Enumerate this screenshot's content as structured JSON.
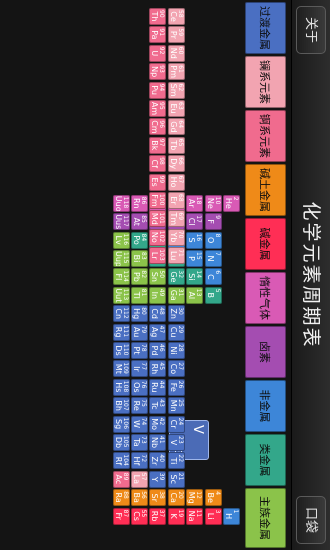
{
  "header": {
    "about_label": "关于",
    "title": "化学元素周期表",
    "back_label": "口袋"
  },
  "legend": [
    {
      "label": "过渡金属",
      "color": "#4a6fc2"
    },
    {
      "label": "镧系元素",
      "color": "#f2a4b1"
    },
    {
      "label": "锕系元素",
      "color": "#f06b8e"
    },
    {
      "label": "碱土金属",
      "color": "#ef8a18"
    },
    {
      "label": "碱金属",
      "color": "#ff2e55"
    },
    {
      "label": "惰性气体",
      "color": "#d95ab5"
    },
    {
      "label": "卤素",
      "color": "#a44db1"
    },
    {
      "label": "非金属",
      "color": "#3d86d8"
    },
    {
      "label": "类金属",
      "color": "#33a78a"
    },
    {
      "label": "主族金属",
      "color": "#8bc34a"
    }
  ],
  "popup": {
    "symbol": "V",
    "number": "23"
  },
  "elements": [
    {
      "s": "H",
      "n": "1",
      "c": "#3d86d8"
    },
    {
      "s": "He",
      "n": "2",
      "c": "#d95ab5"
    },
    {
      "s": "Li",
      "n": "3",
      "c": "#ff2e55"
    },
    {
      "s": "Be",
      "n": "4",
      "c": "#ef8a18"
    },
    {
      "s": "B",
      "n": "5",
      "c": "#33a78a"
    },
    {
      "s": "C",
      "n": "6",
      "c": "#3d86d8"
    },
    {
      "s": "N",
      "n": "7",
      "c": "#3d86d8"
    },
    {
      "s": "O",
      "n": "8",
      "c": "#3d86d8"
    },
    {
      "s": "F",
      "n": "9",
      "c": "#a44db1"
    },
    {
      "s": "Ne",
      "n": "10",
      "c": "#d95ab5"
    },
    {
      "s": "Na",
      "n": "11",
      "c": "#ff2e55"
    },
    {
      "s": "Mg",
      "n": "12",
      "c": "#ef8a18"
    },
    {
      "s": "Al",
      "n": "13",
      "c": "#8bc34a"
    },
    {
      "s": "Si",
      "n": "14",
      "c": "#33a78a"
    },
    {
      "s": "P",
      "n": "15",
      "c": "#3d86d8"
    },
    {
      "s": "S",
      "n": "16",
      "c": "#3d86d8"
    },
    {
      "s": "Cl",
      "n": "17",
      "c": "#a44db1"
    },
    {
      "s": "Ar",
      "n": "18",
      "c": "#d95ab5"
    },
    {
      "s": "K",
      "n": "19",
      "c": "#ff2e55"
    },
    {
      "s": "Ca",
      "n": "20",
      "c": "#ef8a18"
    },
    {
      "s": "Sc",
      "n": "21",
      "c": "#4a6fc2"
    },
    {
      "s": "Ti",
      "n": "22",
      "c": "#4a6fc2"
    },
    {
      "s": "V",
      "n": "23",
      "c": "#4a6fc2"
    },
    {
      "s": "Cr",
      "n": "24",
      "c": "#4a6fc2"
    },
    {
      "s": "Mn",
      "n": "25",
      "c": "#4a6fc2"
    },
    {
      "s": "Fe",
      "n": "26",
      "c": "#4a6fc2"
    },
    {
      "s": "Co",
      "n": "27",
      "c": "#4a6fc2"
    },
    {
      "s": "Ni",
      "n": "28",
      "c": "#4a6fc2"
    },
    {
      "s": "Cu",
      "n": "29",
      "c": "#4a6fc2"
    },
    {
      "s": "Zn",
      "n": "30",
      "c": "#4a6fc2"
    },
    {
      "s": "Ga",
      "n": "31",
      "c": "#8bc34a"
    },
    {
      "s": "Ge",
      "n": "32",
      "c": "#33a78a"
    },
    {
      "s": "As",
      "n": "33",
      "c": "#33a78a"
    },
    {
      "s": "Se",
      "n": "34",
      "c": "#3d86d8"
    },
    {
      "s": "Br",
      "n": "35",
      "c": "#a44db1"
    },
    {
      "s": "Kr",
      "n": "36",
      "c": "#d95ab5"
    },
    {
      "s": "Rb",
      "n": "37",
      "c": "#ff2e55"
    },
    {
      "s": "Sr",
      "n": "38",
      "c": "#ef8a18"
    },
    {
      "s": "Y",
      "n": "39",
      "c": "#4a6fc2"
    },
    {
      "s": "Zr",
      "n": "40",
      "c": "#4a6fc2"
    },
    {
      "s": "Nb",
      "n": "41",
      "c": "#4a6fc2"
    },
    {
      "s": "Mo",
      "n": "42",
      "c": "#4a6fc2"
    },
    {
      "s": "Tc",
      "n": "43",
      "c": "#4a6fc2"
    },
    {
      "s": "Ru",
      "n": "44",
      "c": "#4a6fc2"
    },
    {
      "s": "Rh",
      "n": "45",
      "c": "#4a6fc2"
    },
    {
      "s": "Pd",
      "n": "46",
      "c": "#4a6fc2"
    },
    {
      "s": "Ag",
      "n": "47",
      "c": "#4a6fc2"
    },
    {
      "s": "Cd",
      "n": "48",
      "c": "#4a6fc2"
    },
    {
      "s": "In",
      "n": "49",
      "c": "#8bc34a"
    },
    {
      "s": "Sn",
      "n": "50",
      "c": "#8bc34a"
    },
    {
      "s": "Sb",
      "n": "51",
      "c": "#33a78a"
    },
    {
      "s": "Te",
      "n": "52",
      "c": "#33a78a"
    },
    {
      "s": "I",
      "n": "53",
      "c": "#a44db1"
    },
    {
      "s": "Xe",
      "n": "54",
      "c": "#d95ab5"
    },
    {
      "s": "Cs",
      "n": "55",
      "c": "#ff2e55"
    },
    {
      "s": "Ba",
      "n": "56",
      "c": "#ef8a18"
    },
    {
      "s": "La",
      "n": "57",
      "c": "#f2a4b1"
    },
    {
      "s": "Hf",
      "n": "72",
      "c": "#4a6fc2"
    },
    {
      "s": "Ta",
      "n": "73",
      "c": "#4a6fc2"
    },
    {
      "s": "W",
      "n": "74",
      "c": "#4a6fc2"
    },
    {
      "s": "Re",
      "n": "75",
      "c": "#4a6fc2"
    },
    {
      "s": "Os",
      "n": "76",
      "c": "#4a6fc2"
    },
    {
      "s": "Ir",
      "n": "77",
      "c": "#4a6fc2"
    },
    {
      "s": "Pt",
      "n": "78",
      "c": "#4a6fc2"
    },
    {
      "s": "Au",
      "n": "79",
      "c": "#4a6fc2"
    },
    {
      "s": "Hg",
      "n": "80",
      "c": "#4a6fc2"
    },
    {
      "s": "Tl",
      "n": "81",
      "c": "#8bc34a"
    },
    {
      "s": "Pb",
      "n": "82",
      "c": "#8bc34a"
    },
    {
      "s": "Bi",
      "n": "83",
      "c": "#8bc34a"
    },
    {
      "s": "Po",
      "n": "84",
      "c": "#33a78a"
    },
    {
      "s": "At",
      "n": "85",
      "c": "#a44db1"
    },
    {
      "s": "Rn",
      "n": "86",
      "c": "#d95ab5"
    },
    {
      "s": "Fr",
      "n": "87",
      "c": "#ff2e55"
    },
    {
      "s": "Ra",
      "n": "88",
      "c": "#ef8a18"
    },
    {
      "s": "Ac",
      "n": "89",
      "c": "#f06b8e"
    },
    {
      "s": "Rf",
      "n": "104",
      "c": "#4a6fc2"
    },
    {
      "s": "Db",
      "n": "105",
      "c": "#4a6fc2"
    },
    {
      "s": "Sg",
      "n": "106",
      "c": "#4a6fc2"
    },
    {
      "s": "Bh",
      "n": "107",
      "c": "#4a6fc2"
    },
    {
      "s": "Hs",
      "n": "108",
      "c": "#4a6fc2"
    },
    {
      "s": "Mt",
      "n": "109",
      "c": "#4a6fc2"
    },
    {
      "s": "Ds",
      "n": "110",
      "c": "#4a6fc2"
    },
    {
      "s": "Rg",
      "n": "111",
      "c": "#4a6fc2"
    },
    {
      "s": "Cn",
      "n": "112",
      "c": "#4a6fc2"
    },
    {
      "s": "Uut",
      "n": "113",
      "c": "#8bc34a"
    },
    {
      "s": "Fl",
      "n": "114",
      "c": "#8bc34a"
    },
    {
      "s": "Uup",
      "n": "115",
      "c": "#8bc34a"
    },
    {
      "s": "Lv",
      "n": "116",
      "c": "#8bc34a"
    },
    {
      "s": "Uus",
      "n": "117",
      "c": "#a44db1"
    },
    {
      "s": "Uuo",
      "n": "118",
      "c": "#d95ab5"
    }
  ],
  "lanthanides": [
    {
      "s": "Ce",
      "n": "58"
    },
    {
      "s": "Pr",
      "n": "59"
    },
    {
      "s": "Nd",
      "n": "60"
    },
    {
      "s": "Pm",
      "n": "61"
    },
    {
      "s": "Sm",
      "n": "62"
    },
    {
      "s": "Eu",
      "n": "63"
    },
    {
      "s": "Gd",
      "n": "64"
    },
    {
      "s": "Tb",
      "n": "65"
    },
    {
      "s": "Dy",
      "n": "66"
    },
    {
      "s": "Ho",
      "n": "67"
    },
    {
      "s": "Er",
      "n": "68"
    },
    {
      "s": "Tm",
      "n": "69"
    },
    {
      "s": "Yb",
      "n": "70"
    },
    {
      "s": "Lu",
      "n": "71"
    }
  ],
  "actinides": [
    {
      "s": "Th",
      "n": "90"
    },
    {
      "s": "Pa",
      "n": "91"
    },
    {
      "s": "U",
      "n": "92"
    },
    {
      "s": "Np",
      "n": "93"
    },
    {
      "s": "Pu",
      "n": "94"
    },
    {
      "s": "Am",
      "n": "95"
    },
    {
      "s": "Cm",
      "n": "96"
    },
    {
      "s": "Bk",
      "n": "97"
    },
    {
      "s": "Cf",
      "n": "98"
    },
    {
      "s": "Es",
      "n": "99"
    },
    {
      "s": "Fm",
      "n": "100"
    },
    {
      "s": "Md",
      "n": "101"
    },
    {
      "s": "No",
      "n": "102"
    },
    {
      "s": "Lr",
      "n": "103"
    }
  ],
  "lanthanide_color": "#f2a4b1",
  "actinide_color": "#f06b8e"
}
